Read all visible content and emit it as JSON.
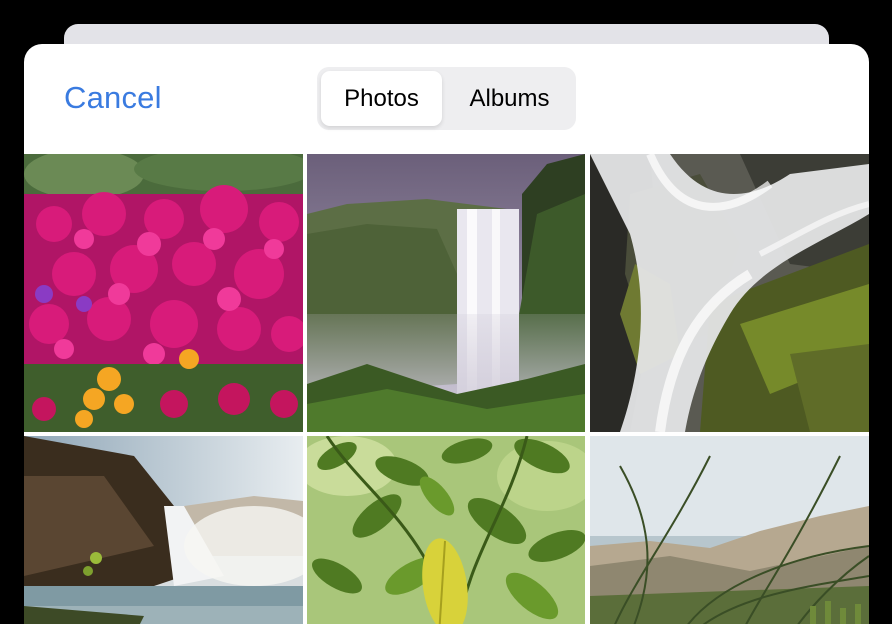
{
  "header": {
    "cancel_label": "Cancel",
    "segments": [
      {
        "label": "Photos",
        "selected": true
      },
      {
        "label": "Albums",
        "selected": false
      }
    ]
  },
  "photos": [
    {
      "subject": "pink-flowers"
    },
    {
      "subject": "waterfall-cliff"
    },
    {
      "subject": "waterfall-rocks"
    },
    {
      "subject": "waterfall-coast"
    },
    {
      "subject": "green-leaves"
    },
    {
      "subject": "dune-grass"
    }
  ],
  "colors": {
    "accent": "#3a7be0",
    "background": "#000000",
    "sheet": "#ffffff",
    "segment_track": "#eeeef0"
  }
}
